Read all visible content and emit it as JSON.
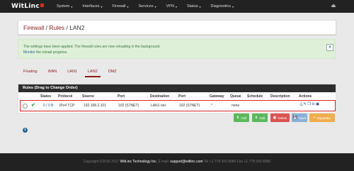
{
  "brand": {
    "name": "WitLinc"
  },
  "nav": {
    "items": [
      {
        "label": "System"
      },
      {
        "label": "Interfaces"
      },
      {
        "label": "Firewall"
      },
      {
        "label": "Services"
      },
      {
        "label": "VPN"
      },
      {
        "label": "Status"
      },
      {
        "label": "Diagnostics"
      }
    ],
    "logout_icon": "sign-out-icon"
  },
  "breadcrumb": {
    "part1": "Firewall",
    "sep1": " / ",
    "part2": "Rules",
    "sep2": " / ",
    "part3": "LAN2"
  },
  "alert": {
    "line1": "The settings have been applied. The firewall rules are now reloading in the background.",
    "link": "Monitor",
    "line2_rest": " the reload progress.",
    "close_icon": "close-icon"
  },
  "tabs": [
    {
      "label": "Floating"
    },
    {
      "label": "WAN"
    },
    {
      "label": "LAN1"
    },
    {
      "label": "LAN2",
      "active": true
    },
    {
      "label": "DMZ"
    }
  ],
  "panel": {
    "title": "Rules (Drag to Change Order)"
  },
  "table": {
    "headers": {
      "states": "States",
      "protocol": "Protocol",
      "source": "Source",
      "port": "Port",
      "destination": "Destination",
      "port2": "Port",
      "gateway": "Gateway",
      "queue": "Queue",
      "schedule": "Schedule",
      "description": "Description",
      "actions": "Actions"
    },
    "rows": [
      {
        "states": "0 / 0 B",
        "protocol": "IPv4 TCP",
        "source": "192.168.2.101",
        "port": "102 (S7NET)",
        "destination": "LAN1 net",
        "port2": "102 (S7NET)",
        "gateway": "*",
        "queue": "none",
        "schedule": "",
        "description": ""
      }
    ]
  },
  "buttons": {
    "add_top": "Add",
    "add_bottom": "Add",
    "delete": "Delete",
    "save": "Save",
    "separator": "Separator"
  },
  "footer": {
    "copyright": "Copyright ©2015-2017",
    "company": "WitLinc Technology Inc.",
    "email_label": "E-mail:",
    "email": "support@witlinc.com",
    "tel": "Tel +1 778 300 8980 Fax +1 778 300 8980"
  },
  "colors": {
    "brand_red": "#8b1a1a",
    "navbar": "#222222",
    "success": "#5cb85c",
    "danger": "#d9534f",
    "primary": "#337ab7",
    "warning": "#f0ad4e"
  }
}
